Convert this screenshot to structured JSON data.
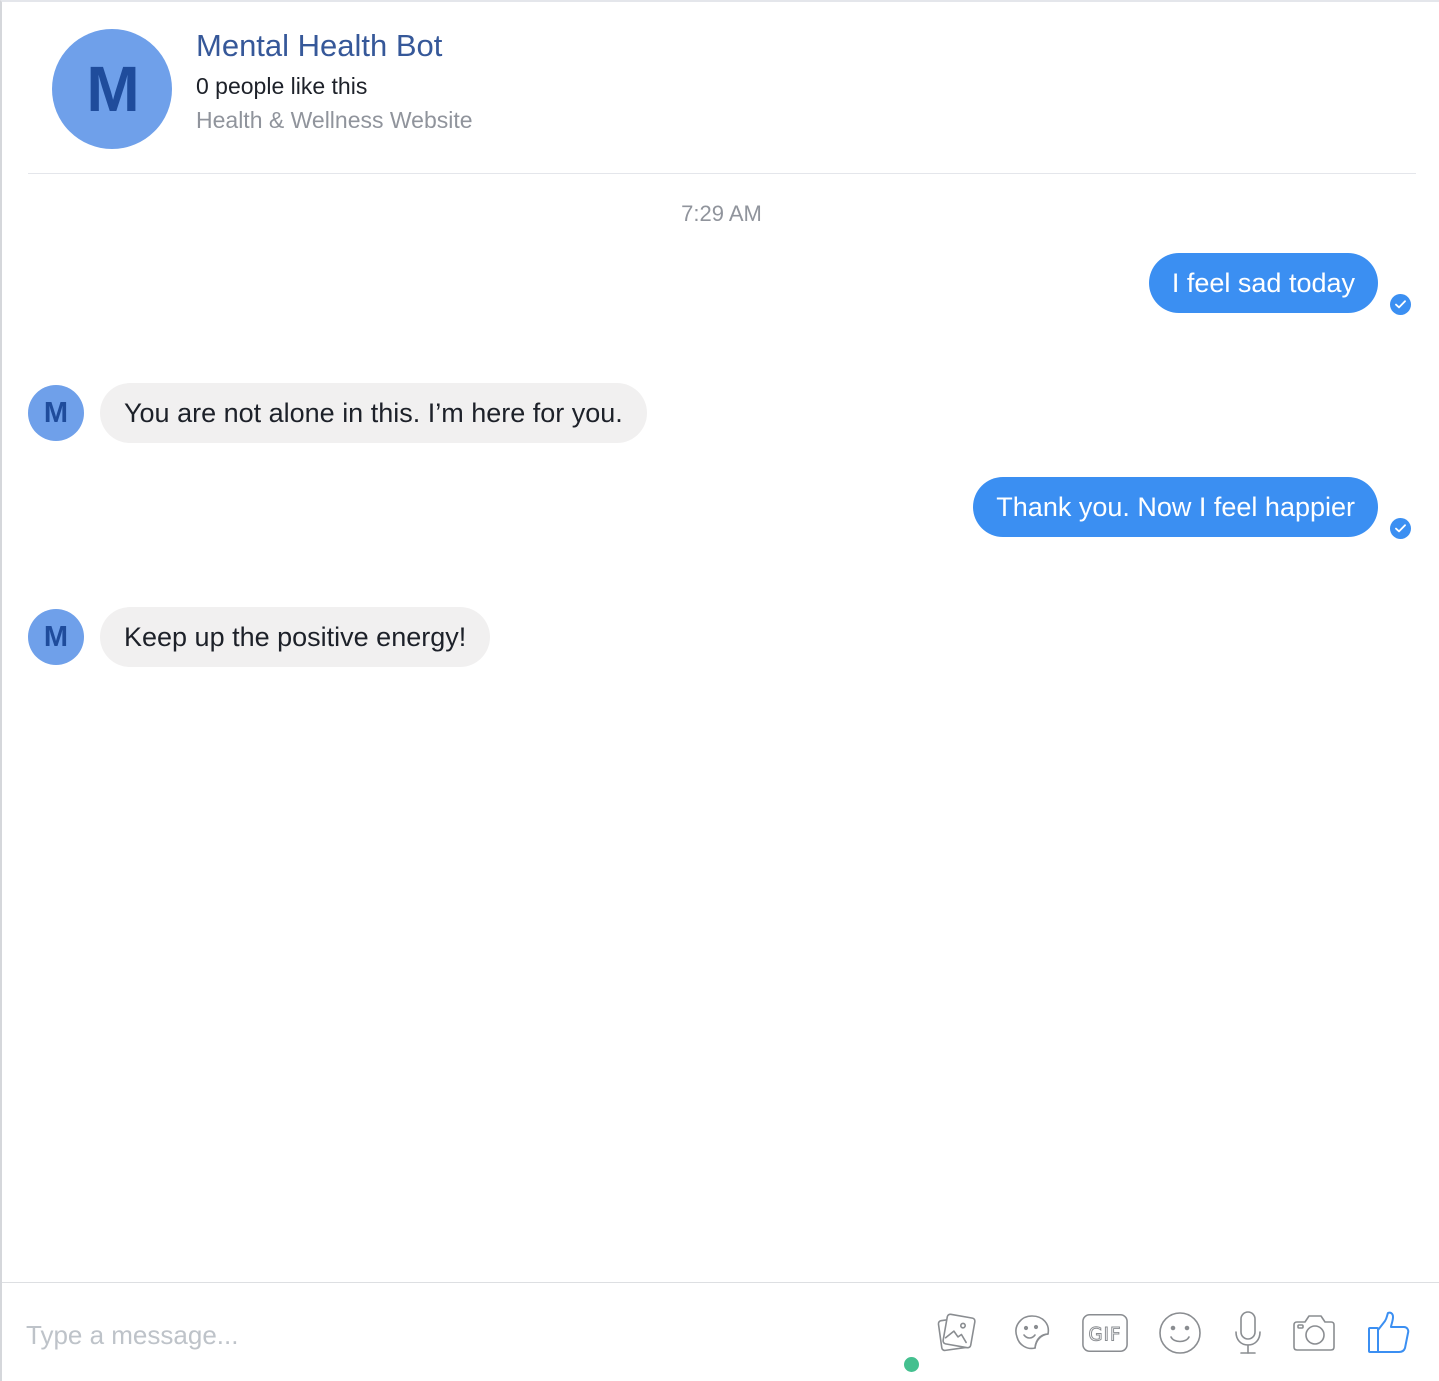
{
  "header": {
    "avatar_letter": "M",
    "bot_name": "Mental Health Bot",
    "likes": "0 people like this",
    "category": "Health & Wellness Website"
  },
  "conversation": {
    "timestamp": "7:29 AM",
    "messages": [
      {
        "sender": "user",
        "text": "I feel sad today",
        "status": "seen"
      },
      {
        "sender": "bot",
        "avatar_letter": "M",
        "text": "You are not alone in this. I’m here for you."
      },
      {
        "sender": "user",
        "text": "Thank you.  Now I feel happier",
        "status": "seen"
      },
      {
        "sender": "bot",
        "avatar_letter": "M",
        "text": "Keep up the positive energy!"
      }
    ]
  },
  "composer": {
    "placeholder": "Type a message...",
    "tools": [
      "photo-icon",
      "sticker-icon",
      "gif-icon",
      "emoji-icon",
      "microphone-icon",
      "camera-icon",
      "like-icon"
    ],
    "gif_label": "GIF"
  },
  "colors": {
    "accent": "#3b8ff2",
    "avatar_bg": "#6fa0ea",
    "avatar_letter": "#1f4c9c",
    "bot_name": "#365899",
    "incoming_bubble": "#f1f0f0",
    "online_dot": "#44c08f",
    "muted_text": "#90949c"
  }
}
